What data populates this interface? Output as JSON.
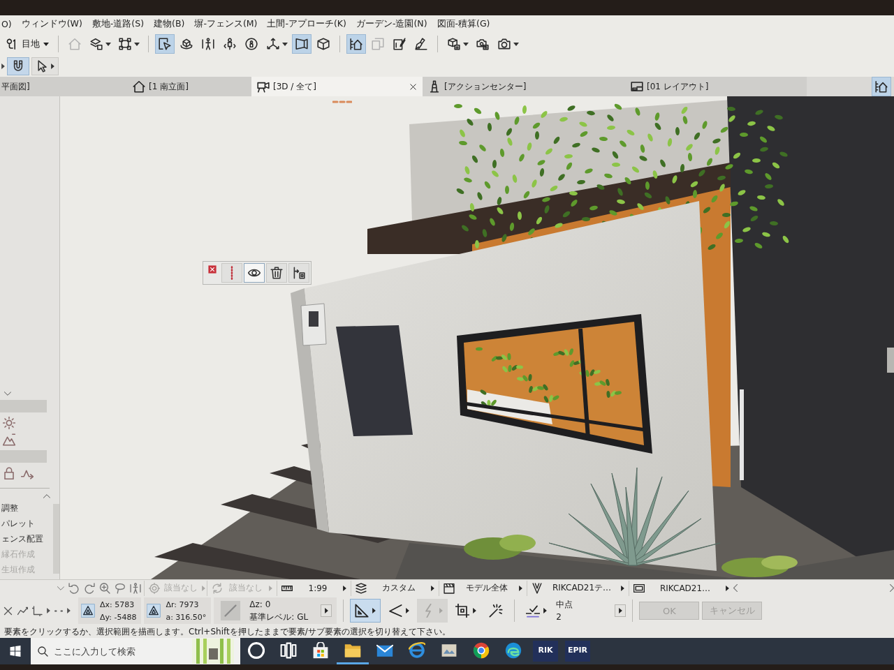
{
  "menu_bar": {
    "items": [
      {
        "label": "O)"
      },
      {
        "label": "ウィンドウ(W)"
      },
      {
        "label": "敷地-道路(S)"
      },
      {
        "label": "建物(B)"
      },
      {
        "label": "塀-フェンス(M)"
      },
      {
        "label": "土間-アプローチ(K)"
      },
      {
        "label": "ガーデン-造園(N)"
      },
      {
        "label": "図面-積算(G)"
      }
    ]
  },
  "toolbar": {
    "layer": {
      "label": "目地",
      "dropdown": true
    },
    "groups": [
      [
        {
          "selected": false,
          "disabled": true,
          "dropdown": false
        },
        {
          "selected": false,
          "disabled": false,
          "dropdown": true
        },
        {
          "selected": false,
          "disabled": false,
          "dropdown": true
        }
      ],
      [
        {
          "selected": true,
          "disabled": false,
          "dropdown": false
        },
        {
          "selected": false,
          "disabled": false,
          "dropdown": false
        },
        {
          "selected": false,
          "disabled": false,
          "dropdown": false
        },
        {
          "selected": false,
          "disabled": false,
          "dropdown": false
        },
        {
          "selected": false,
          "disabled": false,
          "dropdown": false
        },
        {
          "selected": false,
          "disabled": false,
          "dropdown": true
        },
        {
          "selected": true,
          "disabled": false,
          "dropdown": false
        },
        {
          "selected": false,
          "disabled": false,
          "dropdown": false
        }
      ],
      [
        {
          "selected": true,
          "disabled": false,
          "dropdown": false
        },
        {
          "selected": false,
          "disabled": true,
          "dropdown": false
        },
        {
          "selected": false,
          "disabled": false,
          "dropdown": false
        },
        {
          "selected": false,
          "disabled": false,
          "dropdown": false
        }
      ],
      [
        {
          "selected": false,
          "disabled": false,
          "dropdown": true
        },
        {
          "selected": false,
          "disabled": false,
          "dropdown": false
        },
        {
          "selected": false,
          "disabled": false,
          "dropdown": true
        }
      ]
    ]
  },
  "toolbox": {
    "tools": [
      {
        "selected": true,
        "dropdown": false
      },
      {
        "selected": false,
        "dropdown": true
      }
    ]
  },
  "tab_bar": {
    "tabs": [
      {
        "label": "平面図]",
        "selected": false
      },
      {
        "label": "[1 南立面]",
        "selected": false
      },
      {
        "label": "[3D / 全て]",
        "selected": true
      },
      {
        "label": "[アクションセンター]",
        "selected": false
      },
      {
        "label": "[01 レイアウト]",
        "selected": false
      }
    ],
    "view_button": {
      "selected": true
    }
  },
  "side_panel": {
    "items": [
      {
        "label": "調整",
        "disabled": false
      },
      {
        "label": "パレット",
        "disabled": false
      },
      {
        "label": "ェンス配置",
        "disabled": false
      },
      {
        "label": "縁石作成",
        "disabled": true
      },
      {
        "label": "生垣作成",
        "disabled": true
      }
    ]
  },
  "selection_toolbar": {
    "buttons": [
      {
        "selected": false
      },
      {
        "selected": false
      },
      {
        "selected": true
      },
      {
        "selected": false
      },
      {
        "selected": false
      }
    ]
  },
  "info_bar": {
    "items": [
      {
        "label": "該当なし",
        "disabled": true
      },
      {
        "label": "該当なし",
        "disabled": true
      },
      {
        "label": "1:99",
        "disabled": false
      },
      {
        "label": "カスタム",
        "disabled": false
      },
      {
        "label": "モデル全体",
        "disabled": false
      },
      {
        "label": "RIKCAD21テ…",
        "disabled": false
      },
      {
        "label": "RIKCAD21…",
        "disabled": false
      }
    ]
  },
  "coordinate_bar": {
    "dx": "Δx: 5783",
    "dy": "Δy: -5488",
    "dr": "Δr: 7973",
    "angle": "a: 316.50°",
    "dz": "Δz: 0",
    "reference_level": "基準レベル: GL",
    "tools": [
      {
        "selected": true,
        "disabled": false,
        "dropdown": true
      },
      {
        "selected": false,
        "disabled": false,
        "dropdown": true
      },
      {
        "selected": false,
        "disabled": true,
        "dropdown": true
      },
      {
        "selected": false,
        "disabled": false,
        "dropdown": true
      },
      {
        "selected": false,
        "disabled": false,
        "dropdown": false
      }
    ],
    "snap": {
      "label": "中点",
      "value": "2"
    },
    "buttons": [
      {
        "label": "OK",
        "disabled": true
      },
      {
        "label": "キャンセル",
        "disabled": true
      }
    ]
  },
  "status_bar": {
    "message": "要素をクリックするか、選択範囲を描画します。Ctrl+Shiftを押したままで要素/サブ要素の選択を切り替えて下さい。"
  },
  "taskbar": {
    "search": {
      "placeholder": "ここに入力して検索"
    },
    "apps": [
      {
        "running": false
      },
      {
        "running": false
      },
      {
        "running": false
      },
      {
        "running": true
      },
      {
        "running": false
      },
      {
        "running": false
      },
      {
        "running": false
      },
      {
        "running": false
      },
      {
        "running": false
      },
      {
        "running": false,
        "label": "RIK"
      },
      {
        "running": false,
        "label": "EPIR"
      }
    ]
  }
}
